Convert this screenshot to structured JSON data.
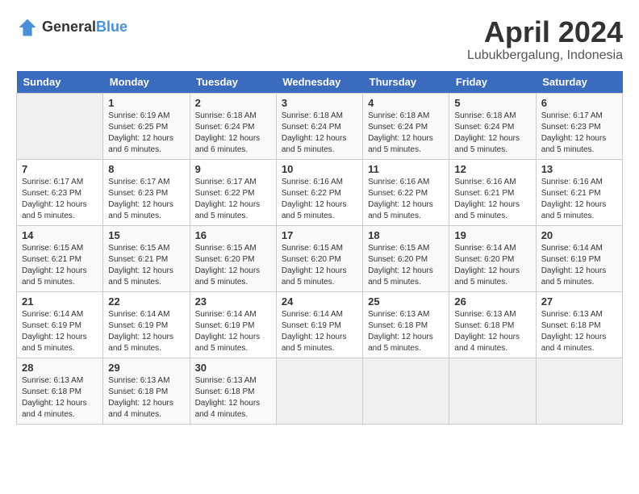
{
  "header": {
    "logo_line1": "General",
    "logo_line2": "Blue",
    "month": "April 2024",
    "location": "Lubukbergalung, Indonesia"
  },
  "days_of_week": [
    "Sunday",
    "Monday",
    "Tuesday",
    "Wednesday",
    "Thursday",
    "Friday",
    "Saturday"
  ],
  "weeks": [
    [
      {
        "day": "",
        "info": ""
      },
      {
        "day": "1",
        "info": "Sunrise: 6:19 AM\nSunset: 6:25 PM\nDaylight: 12 hours\nand 6 minutes."
      },
      {
        "day": "2",
        "info": "Sunrise: 6:18 AM\nSunset: 6:24 PM\nDaylight: 12 hours\nand 6 minutes."
      },
      {
        "day": "3",
        "info": "Sunrise: 6:18 AM\nSunset: 6:24 PM\nDaylight: 12 hours\nand 5 minutes."
      },
      {
        "day": "4",
        "info": "Sunrise: 6:18 AM\nSunset: 6:24 PM\nDaylight: 12 hours\nand 5 minutes."
      },
      {
        "day": "5",
        "info": "Sunrise: 6:18 AM\nSunset: 6:24 PM\nDaylight: 12 hours\nand 5 minutes."
      },
      {
        "day": "6",
        "info": "Sunrise: 6:17 AM\nSunset: 6:23 PM\nDaylight: 12 hours\nand 5 minutes."
      }
    ],
    [
      {
        "day": "7",
        "info": "Sunrise: 6:17 AM\nSunset: 6:23 PM\nDaylight: 12 hours\nand 5 minutes."
      },
      {
        "day": "8",
        "info": "Sunrise: 6:17 AM\nSunset: 6:23 PM\nDaylight: 12 hours\nand 5 minutes."
      },
      {
        "day": "9",
        "info": "Sunrise: 6:17 AM\nSunset: 6:22 PM\nDaylight: 12 hours\nand 5 minutes."
      },
      {
        "day": "10",
        "info": "Sunrise: 6:16 AM\nSunset: 6:22 PM\nDaylight: 12 hours\nand 5 minutes."
      },
      {
        "day": "11",
        "info": "Sunrise: 6:16 AM\nSunset: 6:22 PM\nDaylight: 12 hours\nand 5 minutes."
      },
      {
        "day": "12",
        "info": "Sunrise: 6:16 AM\nSunset: 6:21 PM\nDaylight: 12 hours\nand 5 minutes."
      },
      {
        "day": "13",
        "info": "Sunrise: 6:16 AM\nSunset: 6:21 PM\nDaylight: 12 hours\nand 5 minutes."
      }
    ],
    [
      {
        "day": "14",
        "info": "Sunrise: 6:15 AM\nSunset: 6:21 PM\nDaylight: 12 hours\nand 5 minutes."
      },
      {
        "day": "15",
        "info": "Sunrise: 6:15 AM\nSunset: 6:21 PM\nDaylight: 12 hours\nand 5 minutes."
      },
      {
        "day": "16",
        "info": "Sunrise: 6:15 AM\nSunset: 6:20 PM\nDaylight: 12 hours\nand 5 minutes."
      },
      {
        "day": "17",
        "info": "Sunrise: 6:15 AM\nSunset: 6:20 PM\nDaylight: 12 hours\nand 5 minutes."
      },
      {
        "day": "18",
        "info": "Sunrise: 6:15 AM\nSunset: 6:20 PM\nDaylight: 12 hours\nand 5 minutes."
      },
      {
        "day": "19",
        "info": "Sunrise: 6:14 AM\nSunset: 6:20 PM\nDaylight: 12 hours\nand 5 minutes."
      },
      {
        "day": "20",
        "info": "Sunrise: 6:14 AM\nSunset: 6:19 PM\nDaylight: 12 hours\nand 5 minutes."
      }
    ],
    [
      {
        "day": "21",
        "info": "Sunrise: 6:14 AM\nSunset: 6:19 PM\nDaylight: 12 hours\nand 5 minutes."
      },
      {
        "day": "22",
        "info": "Sunrise: 6:14 AM\nSunset: 6:19 PM\nDaylight: 12 hours\nand 5 minutes."
      },
      {
        "day": "23",
        "info": "Sunrise: 6:14 AM\nSunset: 6:19 PM\nDaylight: 12 hours\nand 5 minutes."
      },
      {
        "day": "24",
        "info": "Sunrise: 6:14 AM\nSunset: 6:19 PM\nDaylight: 12 hours\nand 5 minutes."
      },
      {
        "day": "25",
        "info": "Sunrise: 6:13 AM\nSunset: 6:18 PM\nDaylight: 12 hours\nand 5 minutes."
      },
      {
        "day": "26",
        "info": "Sunrise: 6:13 AM\nSunset: 6:18 PM\nDaylight: 12 hours\nand 4 minutes."
      },
      {
        "day": "27",
        "info": "Sunrise: 6:13 AM\nSunset: 6:18 PM\nDaylight: 12 hours\nand 4 minutes."
      }
    ],
    [
      {
        "day": "28",
        "info": "Sunrise: 6:13 AM\nSunset: 6:18 PM\nDaylight: 12 hours\nand 4 minutes."
      },
      {
        "day": "29",
        "info": "Sunrise: 6:13 AM\nSunset: 6:18 PM\nDaylight: 12 hours\nand 4 minutes."
      },
      {
        "day": "30",
        "info": "Sunrise: 6:13 AM\nSunset: 6:18 PM\nDaylight: 12 hours\nand 4 minutes."
      },
      {
        "day": "",
        "info": ""
      },
      {
        "day": "",
        "info": ""
      },
      {
        "day": "",
        "info": ""
      },
      {
        "day": "",
        "info": ""
      }
    ]
  ]
}
